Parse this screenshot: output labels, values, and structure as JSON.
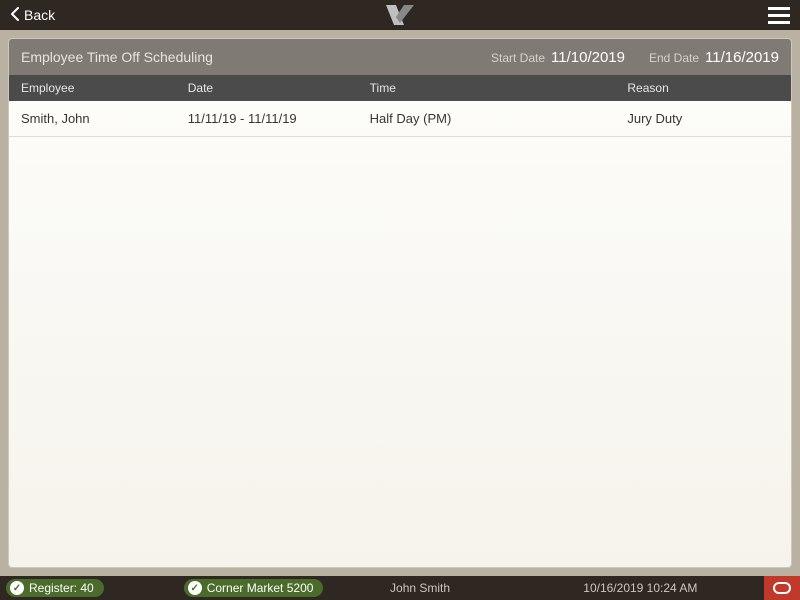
{
  "topbar": {
    "back_label": "Back"
  },
  "panel": {
    "title": "Employee Time Off Scheduling",
    "start_date_label": "Start Date",
    "start_date_value": "11/10/2019",
    "end_date_label": "End Date",
    "end_date_value": "11/16/2019"
  },
  "columns": {
    "employee": "Employee",
    "date": "Date",
    "time": "Time",
    "reason": "Reason"
  },
  "rows": [
    {
      "employee": "Smith, John",
      "date": "11/11/19 - 11/11/19",
      "time": "Half Day (PM)",
      "reason": "Jury Duty"
    }
  ],
  "status": {
    "register_label": "Register: 40",
    "store_label": "Corner Market 5200",
    "user": "John Smith",
    "datetime": "10/16/2019 10:24 AM"
  }
}
